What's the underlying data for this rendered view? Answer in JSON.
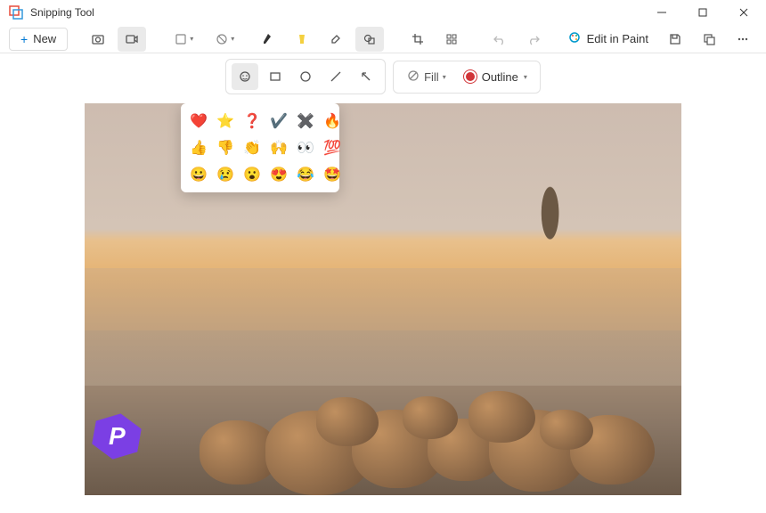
{
  "app": {
    "title": "Snipping Tool"
  },
  "titlebar_buttons": {
    "minimize": "–",
    "maximize": "▢",
    "close": "✕"
  },
  "toolbar": {
    "new_label": "New",
    "edit_in_paint": "Edit in Paint"
  },
  "fill_outline": {
    "fill_label": "Fill",
    "outline_label": "Outline",
    "outline_color": "#d13438"
  },
  "emoji_grid": [
    "❤️",
    "⭐",
    "❓",
    "✔️",
    "✖️",
    "🔥",
    "👍",
    "👎",
    "👏",
    "🙌",
    "👀",
    "💯",
    "😀",
    "😢",
    "😮",
    "😍",
    "😂",
    "🤩"
  ],
  "badge": {
    "letter": "P"
  },
  "icons": {
    "pen": "pen-icon",
    "highlighter": "highlighter-icon",
    "eraser": "eraser-icon",
    "shapes": "shapes-icon",
    "crop": "crop-icon",
    "color_picker": "color-picker-icon",
    "undo": "undo-icon",
    "redo": "redo-icon",
    "camera": "camera-icon",
    "video": "video-icon",
    "shape_dd": "shape-dropdown",
    "cursor_dd": "cursor-dropdown",
    "save": "save-icon",
    "copy": "copy-icon",
    "more": "more-icon",
    "emoji": "emoji-icon",
    "rect": "rectangle-icon",
    "circle": "circle-icon",
    "line": "line-icon",
    "arrow": "arrow-icon",
    "nofill": "no-fill-icon"
  }
}
